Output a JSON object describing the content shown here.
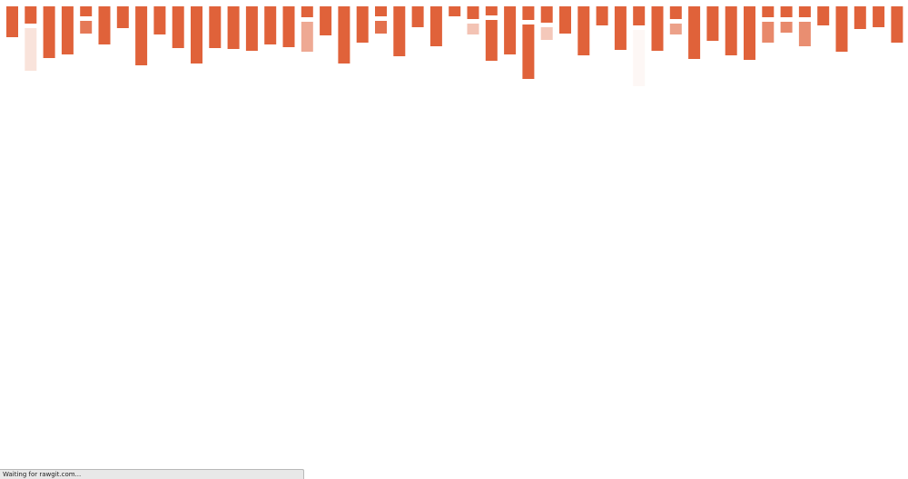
{
  "browser": {
    "status_text": "Waiting for rawgit.com..."
  },
  "chart_data": {
    "type": "bar",
    "orientation": "downward-stacked",
    "color": "#e0623a",
    "title": "",
    "xlabel": "",
    "ylabel": "",
    "axes_visible": false,
    "grid": false,
    "columns": [
      [
        {
          "v": 3.4,
          "o": 1.0
        }
      ],
      [
        {
          "v": 1.9,
          "o": 1.0
        },
        {
          "v": 4.7,
          "o": 0.18
        }
      ],
      [
        {
          "v": 5.7,
          "o": 1.0
        }
      ],
      [
        {
          "v": 5.3,
          "o": 1.0
        }
      ],
      [
        {
          "v": 1.1,
          "o": 1.0
        },
        {
          "v": 1.4,
          "o": 0.85
        }
      ],
      [
        {
          "v": 4.2,
          "o": 1.0
        }
      ],
      [
        {
          "v": 2.4,
          "o": 1.0
        }
      ],
      [
        {
          "v": 6.5,
          "o": 1.0
        }
      ],
      [
        {
          "v": 3.1,
          "o": 1.0
        }
      ],
      [
        {
          "v": 4.6,
          "o": 1.0
        }
      ],
      [
        {
          "v": 6.3,
          "o": 1.0
        }
      ],
      [
        {
          "v": 4.6,
          "o": 1.0
        }
      ],
      [
        {
          "v": 4.7,
          "o": 1.0
        }
      ],
      [
        {
          "v": 4.9,
          "o": 1.0
        }
      ],
      [
        {
          "v": 4.2,
          "o": 1.0
        }
      ],
      [
        {
          "v": 4.5,
          "o": 1.0
        }
      ],
      [
        {
          "v": 1.2,
          "o": 1.0
        },
        {
          "v": 3.3,
          "o": 0.55
        }
      ],
      [
        {
          "v": 3.2,
          "o": 1.0
        }
      ],
      [
        {
          "v": 6.3,
          "o": 1.0
        }
      ],
      [
        {
          "v": 4.0,
          "o": 1.0
        }
      ],
      [
        {
          "v": 1.1,
          "o": 1.0
        },
        {
          "v": 1.4,
          "o": 0.9
        }
      ],
      [
        {
          "v": 5.5,
          "o": 1.0
        }
      ],
      [
        {
          "v": 2.3,
          "o": 1.0
        }
      ],
      [
        {
          "v": 4.4,
          "o": 1.0
        }
      ],
      [
        {
          "v": 1.1,
          "o": 1.0
        }
      ],
      [
        {
          "v": 1.4,
          "o": 1.0
        },
        {
          "v": 1.2,
          "o": 0.38
        }
      ],
      [
        {
          "v": 1.0,
          "o": 1.0
        },
        {
          "v": 4.5,
          "o": 1.0
        }
      ],
      [
        {
          "v": 5.3,
          "o": 1.0
        }
      ],
      [
        {
          "v": 1.5,
          "o": 1.0
        },
        {
          "v": 6.0,
          "o": 1.0
        }
      ],
      [
        {
          "v": 1.8,
          "o": 1.0
        },
        {
          "v": 1.4,
          "o": 0.35
        }
      ],
      [
        {
          "v": 3.0,
          "o": 1.0
        }
      ],
      [
        {
          "v": 5.4,
          "o": 1.0
        }
      ],
      [
        {
          "v": 2.1,
          "o": 1.0
        }
      ],
      [
        {
          "v": 4.8,
          "o": 1.0
        }
      ],
      [
        {
          "v": 2.1,
          "o": 1.0
        },
        {
          "v": 6.2,
          "o": 0.05
        }
      ],
      [
        {
          "v": 4.9,
          "o": 1.0
        }
      ],
      [
        {
          "v": 1.4,
          "o": 1.0
        },
        {
          "v": 1.2,
          "o": 0.6
        }
      ],
      [
        {
          "v": 5.8,
          "o": 1.0
        }
      ],
      [
        {
          "v": 3.8,
          "o": 1.0
        }
      ],
      [
        {
          "v": 5.4,
          "o": 1.0
        }
      ],
      [
        {
          "v": 5.9,
          "o": 1.0
        }
      ],
      [
        {
          "v": 1.2,
          "o": 1.0
        },
        {
          "v": 2.3,
          "o": 0.75
        }
      ],
      [
        {
          "v": 1.2,
          "o": 1.0
        },
        {
          "v": 1.2,
          "o": 0.75
        }
      ],
      [
        {
          "v": 1.2,
          "o": 1.0
        },
        {
          "v": 2.7,
          "o": 0.72
        }
      ],
      [
        {
          "v": 2.1,
          "o": 1.0
        }
      ],
      [
        {
          "v": 5.0,
          "o": 1.0
        }
      ],
      [
        {
          "v": 2.5,
          "o": 1.0
        }
      ],
      [
        {
          "v": 2.3,
          "o": 1.0
        }
      ],
      [
        {
          "v": 4.0,
          "o": 1.0
        }
      ],
      [
        {
          "v": 3.7,
          "o": 1.0
        }
      ]
    ]
  }
}
